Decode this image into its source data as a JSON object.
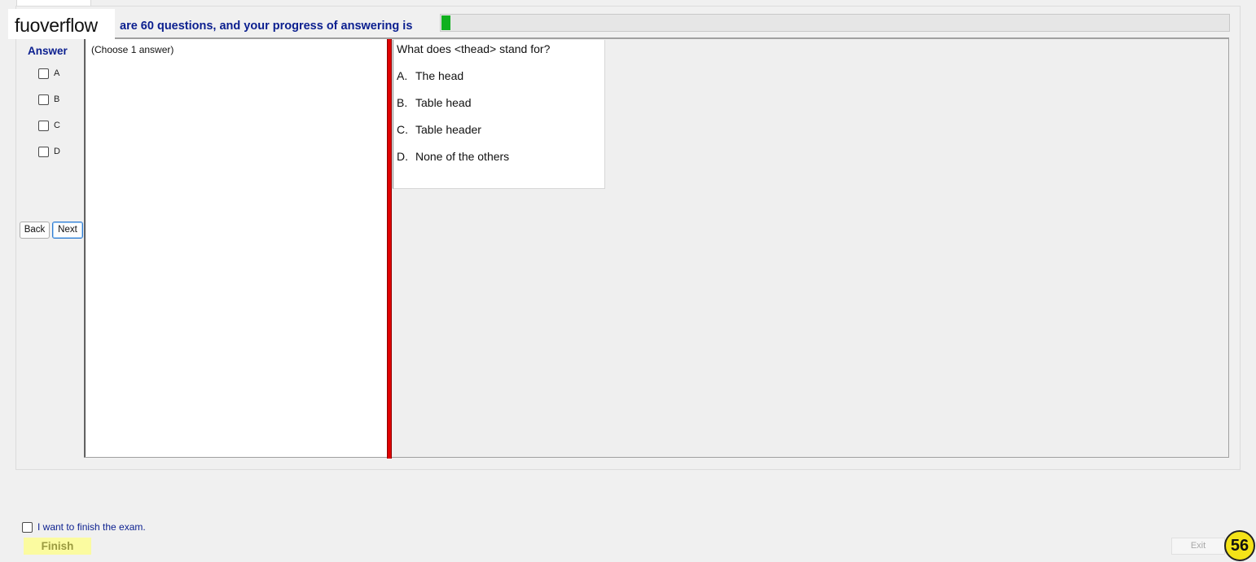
{
  "header": {
    "logo_text": "fuoverflow",
    "progress_text": "are 60 questions, and your progress of answering is",
    "progress_fraction": 0.011
  },
  "answer_panel": {
    "heading": "Answer",
    "options": [
      "A",
      "B",
      "C",
      "D"
    ],
    "back_label": "Back",
    "next_label": "Next"
  },
  "left_panel": {
    "instruction": "(Choose 1 answer)"
  },
  "question": {
    "text": "What does <thead> stand for?",
    "choices": [
      {
        "letter": "A.",
        "text": "The head"
      },
      {
        "letter": "B.",
        "text": "Table head"
      },
      {
        "letter": "C.",
        "text": "Table header"
      },
      {
        "letter": "D.",
        "text": "None of the others"
      }
    ]
  },
  "footer": {
    "finish_check_label": "I want to finish the exam.",
    "finish_label": "Finish",
    "exit_label": "Exit",
    "badge_number": "56"
  },
  "colors": {
    "accent_blue": "#0b1f8f",
    "progress_green": "#10b01e",
    "splitter_red": "#e00000",
    "finish_yellow": "#fbfba0",
    "badge_yellow": "#f4e318"
  }
}
